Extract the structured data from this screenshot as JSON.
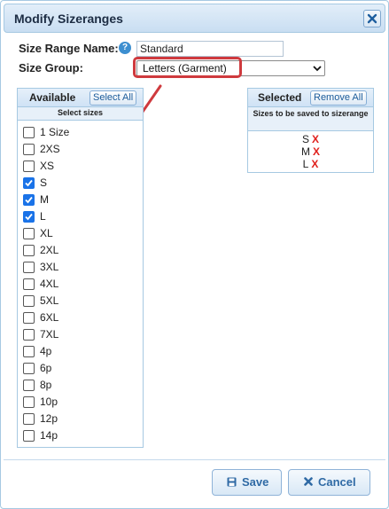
{
  "dialog": {
    "title": "Modify Sizeranges",
    "close_icon": "close-x-icon"
  },
  "form": {
    "name_label": "Size Range Name:",
    "help_icon": "?",
    "name_value": "Standard",
    "group_label": "Size Group:",
    "group_value": "Letters (Garment)"
  },
  "available": {
    "title": "Available",
    "select_all": "Select All",
    "subtitle": "Select sizes",
    "items": [
      {
        "label": "1 Size",
        "checked": false
      },
      {
        "label": "2XS",
        "checked": false
      },
      {
        "label": "XS",
        "checked": false
      },
      {
        "label": "S",
        "checked": true
      },
      {
        "label": "M",
        "checked": true
      },
      {
        "label": "L",
        "checked": true
      },
      {
        "label": "XL",
        "checked": false
      },
      {
        "label": "2XL",
        "checked": false
      },
      {
        "label": "3XL",
        "checked": false
      },
      {
        "label": "4XL",
        "checked": false
      },
      {
        "label": "5XL",
        "checked": false
      },
      {
        "label": "6XL",
        "checked": false
      },
      {
        "label": "7XL",
        "checked": false
      },
      {
        "label": "4p",
        "checked": false
      },
      {
        "label": "6p",
        "checked": false
      },
      {
        "label": "8p",
        "checked": false
      },
      {
        "label": "10p",
        "checked": false
      },
      {
        "label": "12p",
        "checked": false
      },
      {
        "label": "14p",
        "checked": false
      }
    ]
  },
  "selected": {
    "title": "Selected",
    "remove_all": "Remove All",
    "subtitle": "Sizes to be saved to sizerange",
    "items": [
      {
        "label": "S",
        "remove": "X"
      },
      {
        "label": "M",
        "remove": "X"
      },
      {
        "label": "L",
        "remove": "X"
      }
    ]
  },
  "footer": {
    "save_label": "Save",
    "cancel_label": "Cancel"
  },
  "colors": {
    "accent": "#2f6aa5",
    "header_gradient_top": "#e2eef9",
    "border": "#a6c9e2",
    "highlight_red": "#cf3a3e",
    "remove_red": "#e0201c",
    "checkbox_blue": "#1a73e8"
  }
}
